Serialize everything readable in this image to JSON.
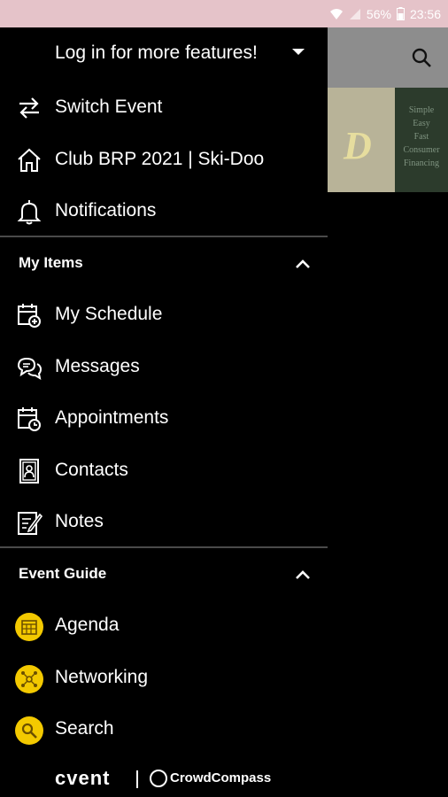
{
  "status_bar": {
    "battery_percent": "56%",
    "time": "23:56"
  },
  "drawer": {
    "login_prompt": "Log in for more features!",
    "top_items": [
      {
        "label": "Switch Event",
        "icon": "switch-arrows-icon"
      },
      {
        "label": "Club BRP 2021 | Ski-Doo",
        "icon": "home-icon"
      },
      {
        "label": "Notifications",
        "icon": "bell-icon"
      }
    ],
    "sections": [
      {
        "title": "My Items",
        "items": [
          {
            "label": "My Schedule",
            "icon": "calendar-add-icon"
          },
          {
            "label": "Messages",
            "icon": "chat-bubbles-icon"
          },
          {
            "label": "Appointments",
            "icon": "calendar-clock-icon"
          },
          {
            "label": "Contacts",
            "icon": "contact-book-icon"
          },
          {
            "label": "Notes",
            "icon": "notepad-icon"
          }
        ]
      },
      {
        "title": "Event Guide",
        "items": [
          {
            "label": "Agenda",
            "icon": "grid-calendar-icon"
          },
          {
            "label": "Networking",
            "icon": "network-icon"
          },
          {
            "label": "Search",
            "icon": "search-icon"
          }
        ]
      }
    ],
    "footer": {
      "brand_left": "cvent",
      "brand_right": "CrowdCompass"
    }
  },
  "background_app": {
    "banner_text": [
      "Simple",
      "Easy",
      "Fast",
      "Consumer",
      "Financing"
    ]
  },
  "colors": {
    "drawer_bg": "#000000",
    "accent_yellow": "#f3c900",
    "status_bar_bg": "#e5c3c9",
    "divider": "#4a4a4a"
  }
}
